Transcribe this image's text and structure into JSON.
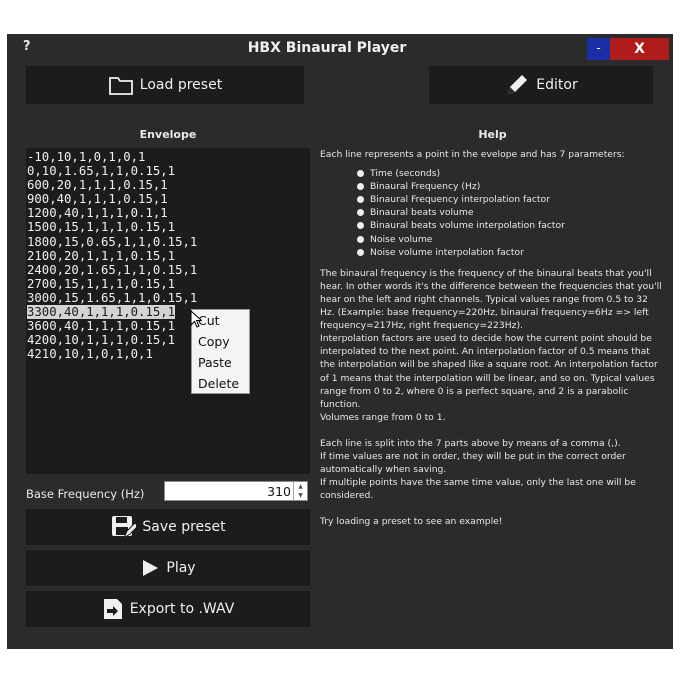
{
  "window": {
    "title": "HBX Binaural Player",
    "help_glyph": "?",
    "minimize_glyph": "-",
    "close_glyph": "X"
  },
  "toolbar": {
    "load_preset_label": "Load preset",
    "editor_label": "Editor"
  },
  "envelope": {
    "heading": "Envelope",
    "lines": [
      "-10,10,1,0,1,0,1",
      "0,10,1.65,1,1,0.15,1",
      "600,20,1,1,1,0.15,1",
      "900,40,1,1,1,0.15,1",
      "1200,40,1,1,1,0.1,1",
      "1500,15,1,1,1,0.15,1",
      "1800,15,0.65,1,1,0.15,1",
      "2100,20,1,1,1,0.15,1",
      "2400,20,1.65,1,1,0.15,1",
      "2700,15,1,1,1,0.15,1",
      "3000,15,1.65,1,1,0.15,1",
      "3300,40,1,1,1,0.15,1",
      "3600,40,1,1,1,0.15,1",
      "4200,10,1,1,1,0.15,1",
      "4210,10,1,0,1,0,1"
    ],
    "selected_line_index": 11
  },
  "context_menu": {
    "items": [
      "Cut",
      "Copy",
      "Paste",
      "Delete"
    ]
  },
  "help": {
    "heading": "Help",
    "intro": "Each line represents a point in the evelope and has 7 parameters:",
    "params": [
      "Time (seconds)",
      "Binaural Frequency (Hz)",
      "Binaural Frequency interpolation factor",
      "Binaural beats volume",
      "Binaural beats volume interpolation factor",
      "Noise volume",
      "Noise volume interpolation factor"
    ],
    "para1": "The binaural frequency is the frequency of the binaural beats that you'll hear. In other words it's the difference between the frequencies that you'll hear on the left and right channels. Typical values range from 0.5 to 32 Hz. (Example: base frequency=220Hz, binaural frequency=6Hz => left frequency=217Hz, right frequency=223Hz).",
    "para2": "Interpolation factors are used to decide how the current point should be interpolated to the next point. An interpolation factor of 0.5 means that the interpolation will be shaped like a square root. An interpolation factor of 1 means that the interpolation will be linear, and so on. Typical values range from 0 to 2, where 0 is a perfect square, and 2 is a parabolic function.",
    "para3": "Volumes range from 0 to 1.",
    "para4": "Each line is split into the 7 parts above by means of a comma (,).",
    "para5": "If time values are not in order, they will be put in the correct order automatically when saving.",
    "para6": "If multiple points have the same time value, only the last one will be considered.",
    "para7": "Try loading a preset to see an example!"
  },
  "base_frequency": {
    "label": "Base Frequency (Hz)",
    "value": "310"
  },
  "actions": {
    "save_label": "Save preset",
    "play_label": "Play",
    "export_label": "Export to .WAV"
  },
  "colors": {
    "window_bg": "#2b2b2b",
    "panel_bg": "#1c1c1c",
    "minimize": "#1a2ea8",
    "close": "#b01c1c"
  }
}
